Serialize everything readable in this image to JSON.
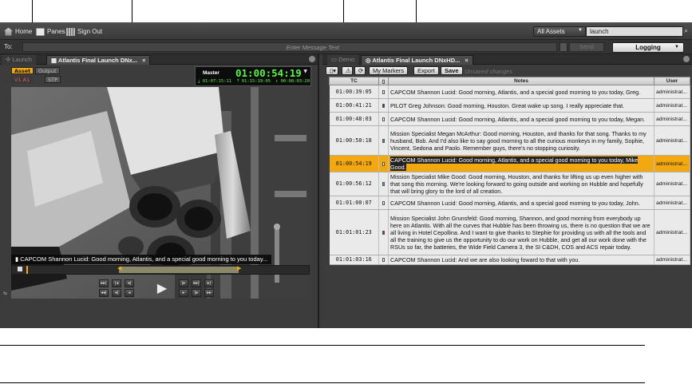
{
  "topbar": {
    "home_label": "Home",
    "panes_label": "Panes",
    "signout_label": "Sign Out",
    "assets_dropdown": "All Assets",
    "search_value": "launch"
  },
  "message_bar": {
    "to_label": "To:",
    "placeholder": "Enter Message Text",
    "send_label": "Send",
    "mode_dropdown": "Logging"
  },
  "left_panel": {
    "tabs": [
      {
        "label": "Launch",
        "active": false
      },
      {
        "label": "Atlantis Final Launch DNx...",
        "active": true
      }
    ],
    "asset_button": "Asset",
    "output_button": "Output",
    "track_label": "V1 A1",
    "stp_label": "STP",
    "timecode": {
      "label": "Master",
      "main": "01:00:54:19",
      "in": "01:07:15:11",
      "out": "01:15:19:05",
      "duration": "00:08:03:20"
    },
    "subtitle": "CAPCOM Shannon Lucid: Good morning, Atlantis, and a special good morning to you today..."
  },
  "right_panel": {
    "tabs": [
      {
        "label": "Demo",
        "active": false
      },
      {
        "label": "Atlantis Final Launch DNxHD...",
        "active": true
      }
    ],
    "toolbar": {
      "my_markers": "My Markers",
      "export": "Export",
      "save": "Save",
      "unsaved": "Unsaved changes"
    },
    "columns": [
      "TC",
      "",
      "Notes",
      "User"
    ],
    "rows": [
      {
        "tc": "01:00:39:05",
        "marker_color": "#ffffff",
        "note": "CAPCOM Shannon Lucid:  Good morning, Atlantis, and a special good morning to you today, Greg.",
        "user": "administrat..."
      },
      {
        "tc": "01:00:41:21",
        "marker_color": "#1f3bd8",
        "note": "PILOT Greg Johnson: Good morning, Houston. Great wake up song. I really appreciate that.",
        "user": "administrat..."
      },
      {
        "tc": "01:00:48:03",
        "marker_color": "#ffffff",
        "note": "CAPCOM Shannon Lucid:  Good morning, Atlantis, and a special good morning to you today, Megan.",
        "user": "administrat..."
      },
      {
        "tc": "01:00:50:18",
        "marker_color": "#2fb52f",
        "note": "Mission Specialist Megan McArthur: Good morning, Houston, and thanks for that song. Thanks to my husband, Bob. And I'd also like to say good morning to all the curious monkeys in my family, Sophie, Vincent, Sedona and Paolo. Remember guys, there's no stopping curiosity.",
        "user": "administrat..."
      },
      {
        "tc": "01:00:54:19",
        "marker_color": "#ffffff",
        "note": "CAPCOM Shannon Lucid: Good morning, Atlantis, and a special good morning to you today, Mike Good.",
        "user": "administrat..."
      },
      {
        "tc": "01:00:56:12",
        "marker_color": "#22b4c8",
        "note": "Mission Specialist Mike Good:  Good morning, Houston, and thanks for lifting us up even higher with that song this morning.  We're looking forward to going outside and working on Hubble and hopefully that will bring glory to the lord of all creation.",
        "user": "administrat..."
      },
      {
        "tc": "01:01:00:07",
        "marker_color": "#ffffff",
        "note": "CAPCOM Shannon Lucid:  Good morning, Atlantis, and a special good morning to you today, John.",
        "user": "administrat..."
      },
      {
        "tc": "01:01:01:23",
        "marker_color": "#d02020",
        "note": "Mission Specialist John Grunsfeld:  Good morning, Shannon, and good morning from everybody up here on Atlantis. With all the curves that Hubble has been throwing us, there is no question that we are all living in Hotel Cepollina. And I want to give thanks to Stephie for providing us with all the tools and all the training to give us the opportunity to do our work on Hubble, and get all our work done with the RSUs so far, the batteries, the Wide Field Camera 3, the SI C&DH, COS and ACS repair today.",
        "user": "administrat..."
      },
      {
        "tc": "01:01:03:16",
        "marker_color": "#ffffff",
        "note": "CAPCOM Shannon Lucid:  And we are also looking foward to that with you.",
        "user": "administrat..."
      }
    ]
  },
  "colors": {
    "accent_selected_row": "#f2a911",
    "timecode_green": "#5cf24a",
    "app_bg": "#3a3a3a"
  }
}
